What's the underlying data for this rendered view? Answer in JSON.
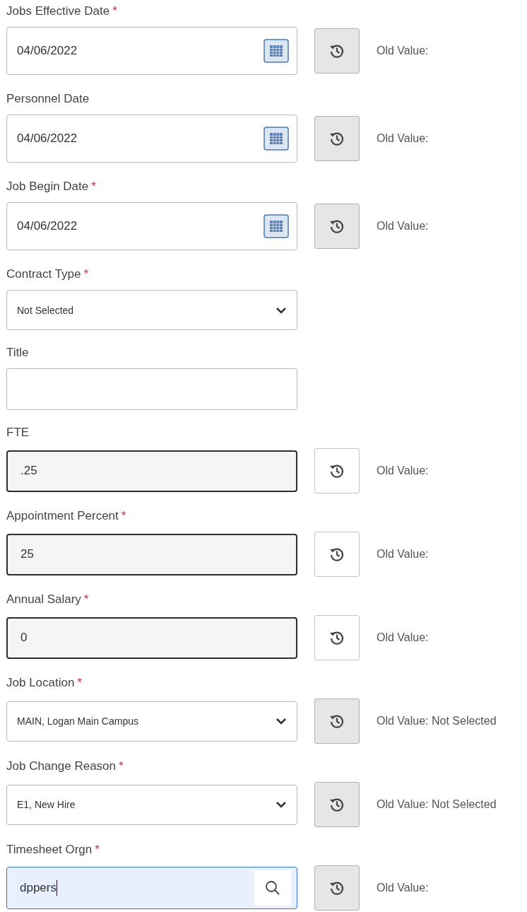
{
  "fields": [
    {
      "kind": "date",
      "label": "Jobs Effective Date",
      "required_mark": "*",
      "value": "04/06/2022",
      "history": {
        "disabled": true,
        "old_value": "Old Value:"
      }
    },
    {
      "kind": "date",
      "label": "Personnel Date",
      "value": "04/06/2022",
      "history": {
        "disabled": true,
        "old_value": "Old Value:"
      }
    },
    {
      "kind": "date",
      "label": "Job Begin Date",
      "required_mark": "*",
      "value": "04/06/2022",
      "history": {
        "disabled": true,
        "old_value": "Old Value:"
      }
    },
    {
      "kind": "select",
      "label": "Contract Type",
      "required_mark": "*",
      "value": "Not Selected"
    },
    {
      "kind": "text",
      "label": "Title",
      "readonly": false
    },
    {
      "kind": "text",
      "label": "FTE",
      "value": ".25",
      "readonly": true,
      "history": {
        "disabled": false,
        "old_value": "Old Value:"
      }
    },
    {
      "kind": "text",
      "label": "Appointment Percent",
      "required_mark": "*",
      "value": "25",
      "readonly": true,
      "history": {
        "disabled": false,
        "old_value": "Old Value:"
      }
    },
    {
      "kind": "text",
      "label": "Annual Salary",
      "required_mark": "*",
      "value": "0",
      "readonly": true,
      "history": {
        "disabled": false,
        "old_value": "Old Value:"
      }
    },
    {
      "kind": "select",
      "label": "Job Location",
      "required_mark": "*",
      "value": "MAIN, Logan Main Campus",
      "history": {
        "disabled": true,
        "old_value": "Old Value: Not Selected"
      }
    },
    {
      "kind": "select",
      "label": "Job Change Reason",
      "required_mark": "*",
      "value": "E1, New Hire",
      "history": {
        "disabled": true,
        "old_value": "Old Value: Not Selected"
      }
    },
    {
      "kind": "search",
      "label": "Timesheet Orgn",
      "required_mark": "*",
      "value": "dppers",
      "focused": true,
      "history": {
        "disabled": true,
        "old_value": "Old Value:"
      }
    }
  ]
}
